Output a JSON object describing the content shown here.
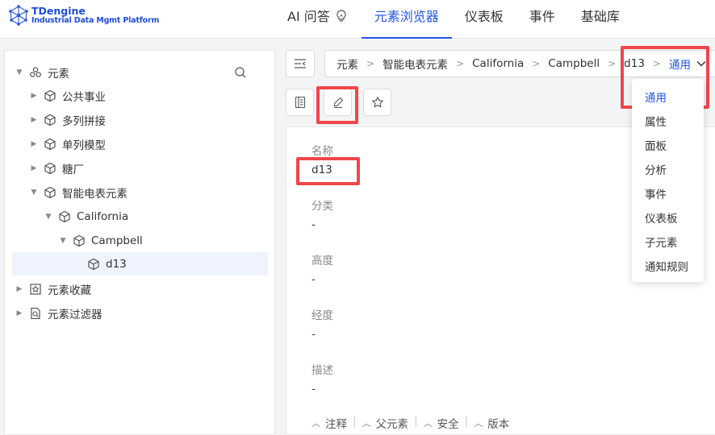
{
  "app": {
    "title": "TDengine",
    "subtitle": "Industrial Data Mgmt Platform"
  },
  "nav": {
    "tabs": [
      {
        "label": "AI 问答"
      },
      {
        "label": "元素浏览器"
      },
      {
        "label": "仪表板"
      },
      {
        "label": "事件"
      },
      {
        "label": "基础库"
      }
    ],
    "active_index": 1
  },
  "tree": {
    "root_label": "元素",
    "items": [
      {
        "label": "公共事业"
      },
      {
        "label": "多列拼接"
      },
      {
        "label": "单列模型"
      },
      {
        "label": "糖厂"
      },
      {
        "label": "智能电表元素"
      },
      {
        "label": "California"
      },
      {
        "label": "Campbell"
      },
      {
        "label": "d13"
      }
    ],
    "favorites_label": "元素收藏",
    "filters_label": "元素过滤器"
  },
  "breadcrumb": {
    "items": [
      "元素",
      "智能电表元素",
      "California",
      "Campbell",
      "d13"
    ],
    "current": "通用"
  },
  "detail": {
    "fields": [
      {
        "label": "名称",
        "value": "d13"
      },
      {
        "label": "分类",
        "value": "-"
      },
      {
        "label": "高度",
        "value": "-"
      },
      {
        "label": "经度",
        "value": "-"
      },
      {
        "label": "描述",
        "value": "-"
      }
    ],
    "footer_links": [
      "注释",
      "父元素",
      "安全",
      "版本"
    ]
  },
  "dropdown": {
    "items": [
      "通用",
      "属性",
      "面板",
      "分析",
      "事件",
      "仪表板",
      "子元素",
      "通知规则"
    ],
    "selected": "通用"
  },
  "colors": {
    "accent": "#2255e6",
    "highlight_box": "#f0464b",
    "selected_row": "#eef3fd"
  }
}
